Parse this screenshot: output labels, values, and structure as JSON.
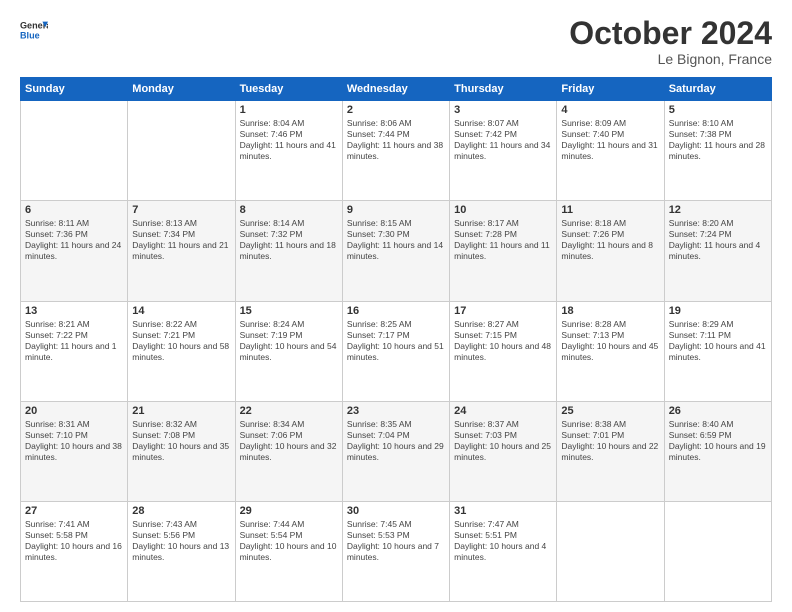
{
  "logo": {
    "general": "General",
    "blue": "Blue"
  },
  "header": {
    "month": "October 2024",
    "location": "Le Bignon, France"
  },
  "days_of_week": [
    "Sunday",
    "Monday",
    "Tuesday",
    "Wednesday",
    "Thursday",
    "Friday",
    "Saturday"
  ],
  "weeks": [
    [
      {
        "day": "",
        "info": ""
      },
      {
        "day": "",
        "info": ""
      },
      {
        "day": "1",
        "info": "Sunrise: 8:04 AM\nSunset: 7:46 PM\nDaylight: 11 hours and 41 minutes."
      },
      {
        "day": "2",
        "info": "Sunrise: 8:06 AM\nSunset: 7:44 PM\nDaylight: 11 hours and 38 minutes."
      },
      {
        "day": "3",
        "info": "Sunrise: 8:07 AM\nSunset: 7:42 PM\nDaylight: 11 hours and 34 minutes."
      },
      {
        "day": "4",
        "info": "Sunrise: 8:09 AM\nSunset: 7:40 PM\nDaylight: 11 hours and 31 minutes."
      },
      {
        "day": "5",
        "info": "Sunrise: 8:10 AM\nSunset: 7:38 PM\nDaylight: 11 hours and 28 minutes."
      }
    ],
    [
      {
        "day": "6",
        "info": "Sunrise: 8:11 AM\nSunset: 7:36 PM\nDaylight: 11 hours and 24 minutes."
      },
      {
        "day": "7",
        "info": "Sunrise: 8:13 AM\nSunset: 7:34 PM\nDaylight: 11 hours and 21 minutes."
      },
      {
        "day": "8",
        "info": "Sunrise: 8:14 AM\nSunset: 7:32 PM\nDaylight: 11 hours and 18 minutes."
      },
      {
        "day": "9",
        "info": "Sunrise: 8:15 AM\nSunset: 7:30 PM\nDaylight: 11 hours and 14 minutes."
      },
      {
        "day": "10",
        "info": "Sunrise: 8:17 AM\nSunset: 7:28 PM\nDaylight: 11 hours and 11 minutes."
      },
      {
        "day": "11",
        "info": "Sunrise: 8:18 AM\nSunset: 7:26 PM\nDaylight: 11 hours and 8 minutes."
      },
      {
        "day": "12",
        "info": "Sunrise: 8:20 AM\nSunset: 7:24 PM\nDaylight: 11 hours and 4 minutes."
      }
    ],
    [
      {
        "day": "13",
        "info": "Sunrise: 8:21 AM\nSunset: 7:22 PM\nDaylight: 11 hours and 1 minute."
      },
      {
        "day": "14",
        "info": "Sunrise: 8:22 AM\nSunset: 7:21 PM\nDaylight: 10 hours and 58 minutes."
      },
      {
        "day": "15",
        "info": "Sunrise: 8:24 AM\nSunset: 7:19 PM\nDaylight: 10 hours and 54 minutes."
      },
      {
        "day": "16",
        "info": "Sunrise: 8:25 AM\nSunset: 7:17 PM\nDaylight: 10 hours and 51 minutes."
      },
      {
        "day": "17",
        "info": "Sunrise: 8:27 AM\nSunset: 7:15 PM\nDaylight: 10 hours and 48 minutes."
      },
      {
        "day": "18",
        "info": "Sunrise: 8:28 AM\nSunset: 7:13 PM\nDaylight: 10 hours and 45 minutes."
      },
      {
        "day": "19",
        "info": "Sunrise: 8:29 AM\nSunset: 7:11 PM\nDaylight: 10 hours and 41 minutes."
      }
    ],
    [
      {
        "day": "20",
        "info": "Sunrise: 8:31 AM\nSunset: 7:10 PM\nDaylight: 10 hours and 38 minutes."
      },
      {
        "day": "21",
        "info": "Sunrise: 8:32 AM\nSunset: 7:08 PM\nDaylight: 10 hours and 35 minutes."
      },
      {
        "day": "22",
        "info": "Sunrise: 8:34 AM\nSunset: 7:06 PM\nDaylight: 10 hours and 32 minutes."
      },
      {
        "day": "23",
        "info": "Sunrise: 8:35 AM\nSunset: 7:04 PM\nDaylight: 10 hours and 29 minutes."
      },
      {
        "day": "24",
        "info": "Sunrise: 8:37 AM\nSunset: 7:03 PM\nDaylight: 10 hours and 25 minutes."
      },
      {
        "day": "25",
        "info": "Sunrise: 8:38 AM\nSunset: 7:01 PM\nDaylight: 10 hours and 22 minutes."
      },
      {
        "day": "26",
        "info": "Sunrise: 8:40 AM\nSunset: 6:59 PM\nDaylight: 10 hours and 19 minutes."
      }
    ],
    [
      {
        "day": "27",
        "info": "Sunrise: 7:41 AM\nSunset: 5:58 PM\nDaylight: 10 hours and 16 minutes."
      },
      {
        "day": "28",
        "info": "Sunrise: 7:43 AM\nSunset: 5:56 PM\nDaylight: 10 hours and 13 minutes."
      },
      {
        "day": "29",
        "info": "Sunrise: 7:44 AM\nSunset: 5:54 PM\nDaylight: 10 hours and 10 minutes."
      },
      {
        "day": "30",
        "info": "Sunrise: 7:45 AM\nSunset: 5:53 PM\nDaylight: 10 hours and 7 minutes."
      },
      {
        "day": "31",
        "info": "Sunrise: 7:47 AM\nSunset: 5:51 PM\nDaylight: 10 hours and 4 minutes."
      },
      {
        "day": "",
        "info": ""
      },
      {
        "day": "",
        "info": ""
      }
    ]
  ]
}
